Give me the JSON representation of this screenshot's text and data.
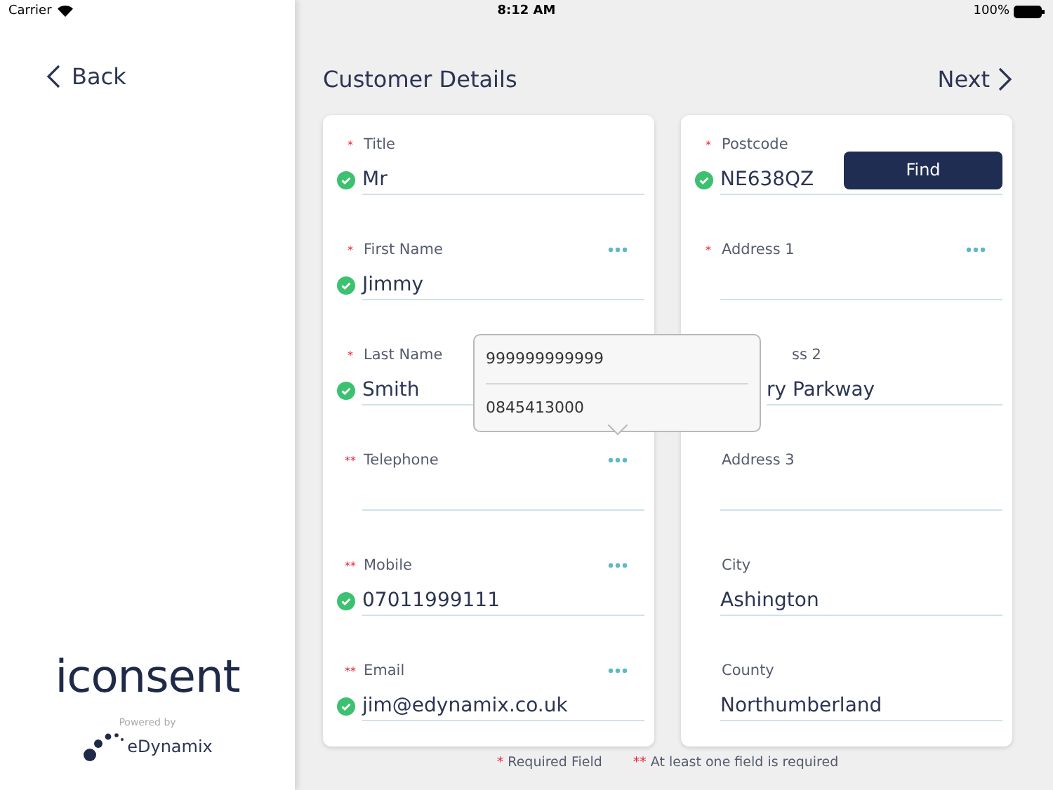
{
  "status_bar": {
    "carrier": "Carrier",
    "time": "8:12 AM",
    "battery": "100%"
  },
  "sidebar": {
    "back": "Back",
    "logo": "iconsent",
    "powered_by": "Powered by",
    "partner": "eDynamix"
  },
  "header": {
    "title": "Customer Details",
    "next": "Next"
  },
  "cards": [
    {
      "fields": [
        {
          "kind": "plain",
          "marker": "*",
          "label": "Title",
          "value": "Mr",
          "valid": true,
          "more": false
        },
        {
          "kind": "plain",
          "marker": "*",
          "label": "First Name",
          "value": "Jimmy",
          "valid": true,
          "more": true
        },
        {
          "kind": "plain",
          "marker": "*",
          "label": "Last Name",
          "value": "Smith",
          "valid": true,
          "more": false
        },
        {
          "kind": "plain",
          "marker": "**",
          "label": "Telephone",
          "valid": false,
          "more": true
        },
        {
          "kind": "plain",
          "marker": "**",
          "label": "Mobile",
          "value": "07011999111",
          "valid": true,
          "more": true
        },
        {
          "kind": "plain",
          "marker": "**",
          "label": "Email",
          "value": "jim@edynamix.co.uk",
          "valid": true,
          "more": true
        }
      ]
    },
    {
      "fields": [
        {
          "kind": "plain",
          "marker": "*",
          "label": "Postcode",
          "value": "NE638QZ",
          "valid": true,
          "more": false,
          "button": "Find"
        },
        {
          "kind": "plain",
          "marker": "*",
          "label": "Address 1",
          "valid": false,
          "more": true
        },
        {
          "kind": "covered",
          "label": "ss 2",
          "value": "ry Parkway",
          "more": false
        },
        {
          "kind": "plain",
          "label": "Address 3",
          "valid": false,
          "more": false
        },
        {
          "kind": "plain",
          "label": "City",
          "value": "Ashington",
          "valid": false,
          "more": false
        },
        {
          "kind": "plain",
          "label": "County",
          "value": "Northumberland",
          "valid": false,
          "more": false
        }
      ]
    }
  ],
  "popover": {
    "options": [
      "999999999999",
      "0845413000"
    ]
  },
  "legend": [
    {
      "marker": "*",
      "text": "Required Field"
    },
    {
      "marker": "**",
      "text": "At least one field is required"
    }
  ]
}
